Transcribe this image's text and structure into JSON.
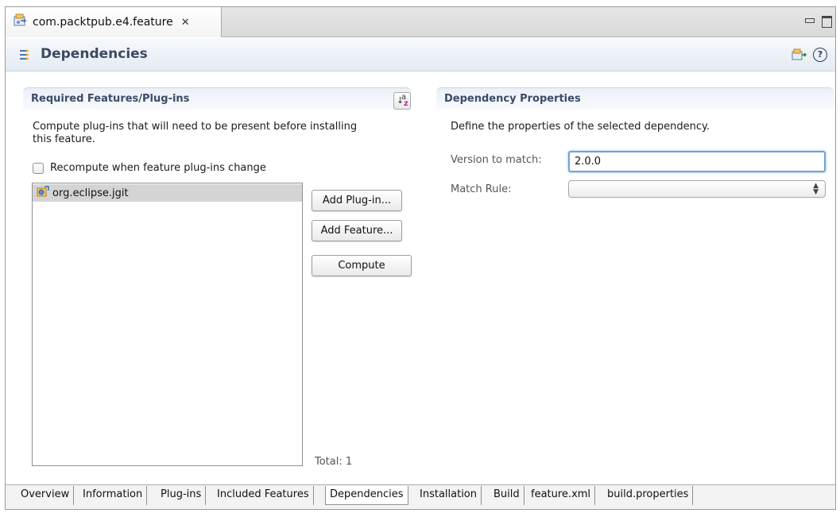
{
  "editor": {
    "tab_title": "com.packtpub.e4.feature",
    "close_symbol": "✕"
  },
  "header": {
    "title": "Dependencies",
    "help_symbol": "?"
  },
  "left_section": {
    "title": "Required Features/Plug-ins",
    "description_line1": "Compute plug-ins that will need to be present before installing",
    "description_line2": "this feature.",
    "recompute_label": "Recompute when feature plug-ins change",
    "recompute_checked": false,
    "items": [
      {
        "label": "org.eclipse.jgit",
        "selected": true
      }
    ],
    "buttons": {
      "add_plugin": "Add Plug-in...",
      "add_feature": "Add Feature...",
      "compute": "Compute"
    },
    "total": "Total: 1",
    "sort_icon": {
      "a": "a",
      "z": "z",
      "arrow": "↓"
    }
  },
  "right_section": {
    "title": "Dependency Properties",
    "description": "Define the properties of the selected dependency.",
    "version_label": "Version to match:",
    "version_value": "2.0.0",
    "match_rule_label": "Match Rule:",
    "match_rule_value": ""
  },
  "page_tabs": [
    {
      "label": "Overview",
      "active": false
    },
    {
      "label": "Information",
      "active": false
    },
    {
      "label": "Plug-ins",
      "active": false
    },
    {
      "label": "Included Features",
      "active": false
    },
    {
      "label": "Dependencies",
      "active": true
    },
    {
      "label": "Installation",
      "active": false
    },
    {
      "label": "Build",
      "active": false
    },
    {
      "label": "feature.xml",
      "active": false
    },
    {
      "label": "build.properties",
      "active": false
    }
  ]
}
